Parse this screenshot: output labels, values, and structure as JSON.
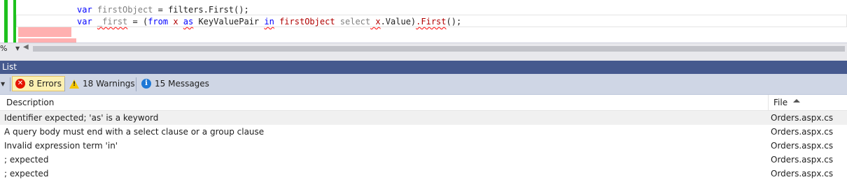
{
  "editor": {
    "line1": {
      "kw_var": "var",
      "name": "firstObject",
      "rest": " = filters.First();"
    },
    "line2": {
      "kw_var": "var",
      "name": "_first",
      "eq": " = (",
      "kw_from": "from",
      "x1": " x ",
      "kw_as": "as",
      "type": " KeyValuePair ",
      "kw_in": "in",
      "source": " firstObject ",
      "kw_select": "select",
      "x2": " x",
      "value": ".Value)",
      "first": ".First",
      "end": "();"
    }
  },
  "zoom": {
    "value": "%"
  },
  "panel": {
    "title": "List"
  },
  "toolbar": {
    "errors_label": "8 Errors",
    "warnings_label": "18 Warnings",
    "messages_label": "15 Messages"
  },
  "columns": {
    "description": "Description",
    "file": "File"
  },
  "errors": [
    {
      "description": "Identifier expected; 'as' is a keyword",
      "file": "Orders.aspx.cs"
    },
    {
      "description": "A query body must end with a select clause or a group clause",
      "file": "Orders.aspx.cs"
    },
    {
      "description": "Invalid expression term 'in'",
      "file": "Orders.aspx.cs"
    },
    {
      "description": "; expected",
      "file": "Orders.aspx.cs"
    },
    {
      "description": "; expected",
      "file": "Orders.aspx.cs"
    }
  ],
  "colors": {
    "panel_header": "#45598e",
    "toolbar_bg": "#cfd6e5",
    "active_filter": "#fcf0b2",
    "error_icon": "#e51400",
    "warning_icon": "#f6c600",
    "info_icon": "#1e78d6",
    "change_bar": "#1ec11e"
  }
}
